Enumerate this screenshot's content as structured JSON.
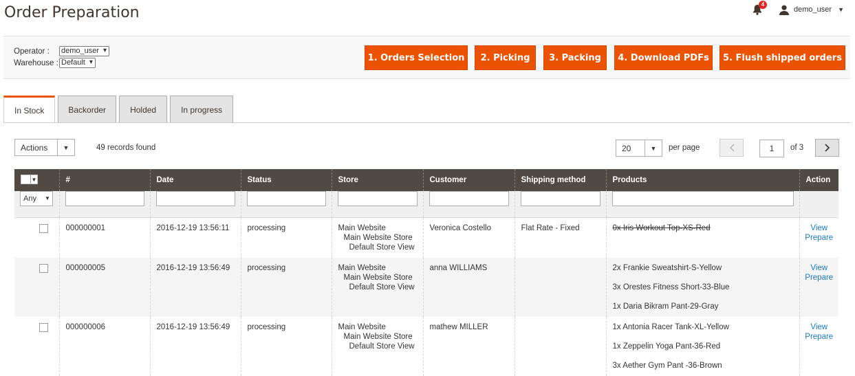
{
  "header": {
    "title": "Order Preparation",
    "notification_count": "4",
    "username": "demo_user"
  },
  "toolbar": {
    "operator_label": "Operator :",
    "operator_value": "demo_user",
    "warehouse_label": "Warehouse :",
    "warehouse_value": "Default",
    "buttons": [
      "1. Orders Selection",
      "2. Picking",
      "3. Packing",
      "4. Download PDFs",
      "5. Flush shipped orders"
    ]
  },
  "tabs": [
    "In Stock",
    "Backorder",
    "Holded",
    "In progress"
  ],
  "grid_controls": {
    "actions_label": "Actions",
    "records_found": "49 records found",
    "per_page_value": "20",
    "per_page_label": "per page",
    "current_page": "1",
    "total_pages": "of 3"
  },
  "table": {
    "columns": [
      "#",
      "Date",
      "Status",
      "Store",
      "Customer",
      "Shipping method",
      "Products",
      "Action"
    ],
    "filter_any": "Any",
    "rows": [
      {
        "id": "000000001",
        "date": "2016-12-19 13:56:11",
        "status": "processing",
        "store": [
          "Main Website",
          "Main Website Store",
          "Default Store View"
        ],
        "customer": "Veronica Costello",
        "shipping": "Flat Rate - Fixed",
        "products": [
          "0x Iris Workout Top-XS-Red"
        ],
        "products_struck": true,
        "action_view": "View",
        "action_prepare": "Prepare"
      },
      {
        "id": "000000005",
        "date": "2016-12-19 13:56:49",
        "status": "processing",
        "store": [
          "Main Website",
          "Main Website Store",
          "Default Store View"
        ],
        "customer": "anna WILLIAMS",
        "shipping": "",
        "products": [
          "2x Frankie Sweatshirt-S-Yellow",
          "3x Orestes Fitness Short-33-Blue",
          "1x Daria Bikram Pant-29-Gray"
        ],
        "products_struck": false,
        "action_view": "View",
        "action_prepare": "Prepare"
      },
      {
        "id": "000000006",
        "date": "2016-12-19 13:56:49",
        "status": "processing",
        "store": [
          "Main Website",
          "Main Website Store",
          "Default Store View"
        ],
        "customer": "mathew MILLER",
        "shipping": "",
        "products": [
          "1x Antonia Racer Tank-XL-Yellow",
          "1x Zeppelin Yoga Pant-36-Red",
          "3x Aether Gym Pant -36-Brown"
        ],
        "products_struck": false,
        "action_view": "View",
        "action_prepare": "Prepare"
      }
    ]
  },
  "colors": {
    "accent": "#eb5202",
    "table_header": "#514943",
    "link": "#1979c3"
  }
}
